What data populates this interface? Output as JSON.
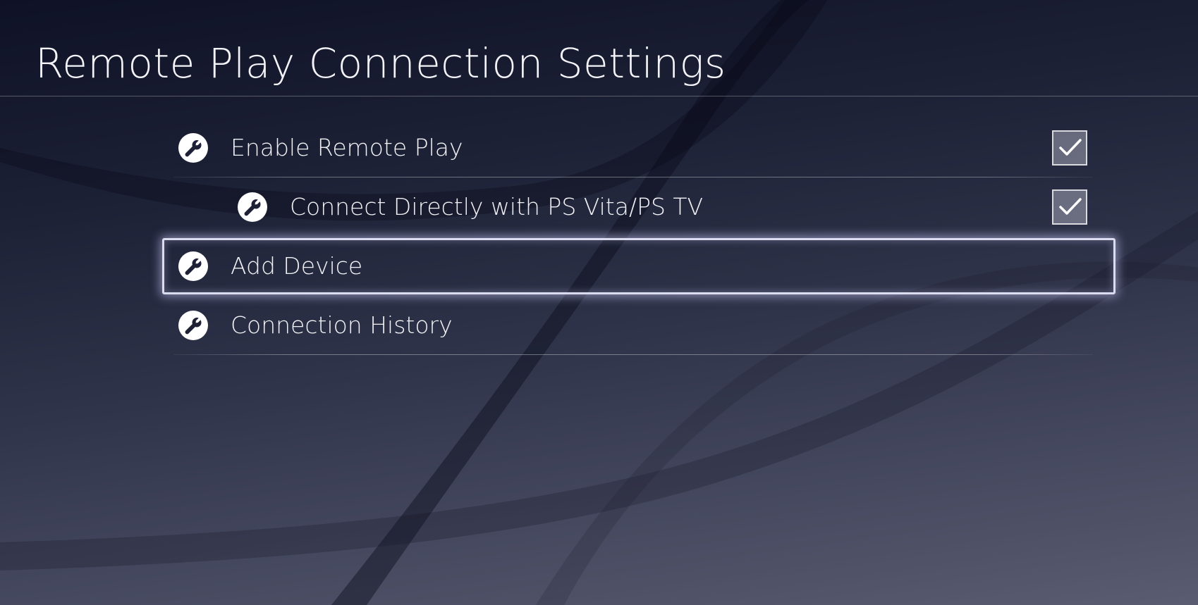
{
  "header": {
    "title": "Remote Play Connection Settings"
  },
  "settings": [
    {
      "label": "Enable Remote Play",
      "icon": "wrench-icon",
      "checked": true
    },
    {
      "label": "Connect Directly with PS Vita/PS TV",
      "icon": "wrench-icon",
      "checked": true
    },
    {
      "label": "Add Device",
      "icon": "wrench-icon",
      "focused": true
    },
    {
      "label": "Connection History",
      "icon": "wrench-icon"
    }
  ],
  "colors": {
    "background_top": "#0f1226",
    "background_bottom": "#5a5c71",
    "text": "#f2f2f6",
    "focus_glow": "#d2d2ff"
  }
}
